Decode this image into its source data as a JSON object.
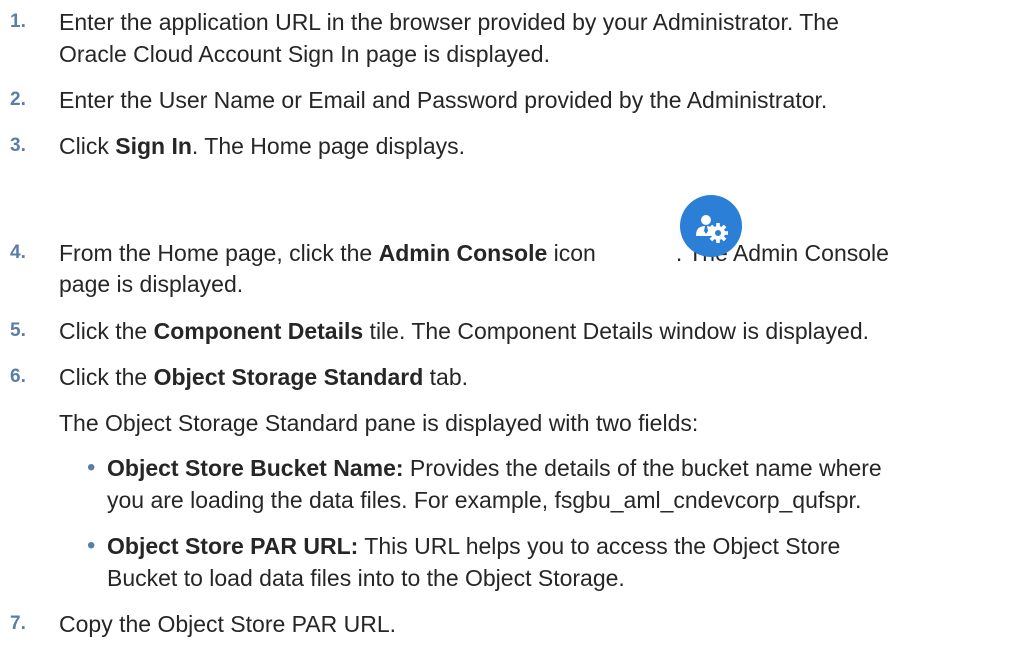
{
  "steps": [
    {
      "number": "1.",
      "line1": "Enter the application URL in the browser provided by your Administrator. The",
      "line2": "Oracle Cloud Account Sign In page is displayed."
    },
    {
      "number": "2.",
      "text": "Enter the User Name or Email and Password provided by the Administrator."
    },
    {
      "number": "3.",
      "prefix": "Click ",
      "bold": "Sign In",
      "suffix": ". The Home page displays."
    },
    {
      "number": "4.",
      "prefix": "From the Home page, click the ",
      "bold": "Admin Console",
      "mid": " icon",
      "after_icon": ". The Admin Console",
      "line2": "page is displayed.",
      "icon": "admin-console-icon"
    },
    {
      "number": "5.",
      "prefix": "Click the ",
      "bold": "Component Details",
      "suffix": " tile. The Component Details window is displayed."
    },
    {
      "number": "6.",
      "prefix": "Click the ",
      "bold": "Object Storage Standard",
      "suffix": " tab.",
      "para": "The Object Storage Standard pane is displayed with two fields:",
      "bullets": [
        {
          "bold": "Object Store Bucket Name:",
          "line1": " Provides the details of the bucket name where",
          "line2": "you are loading the data files. For example, fsgbu_aml_cndevcorp_qufspr."
        },
        {
          "bold": "Object Store PAR URL:",
          "line1": " This URL helps you to access the Object Store",
          "line2": "Bucket to load data files into to the Object Storage."
        }
      ]
    },
    {
      "number": "7.",
      "text": "Copy the Object Store PAR URL."
    }
  ],
  "colors": {
    "number": "#5a7ea8",
    "text": "#262626",
    "icon_bg": "#2b7fd6"
  },
  "bullet_glyph": "•"
}
